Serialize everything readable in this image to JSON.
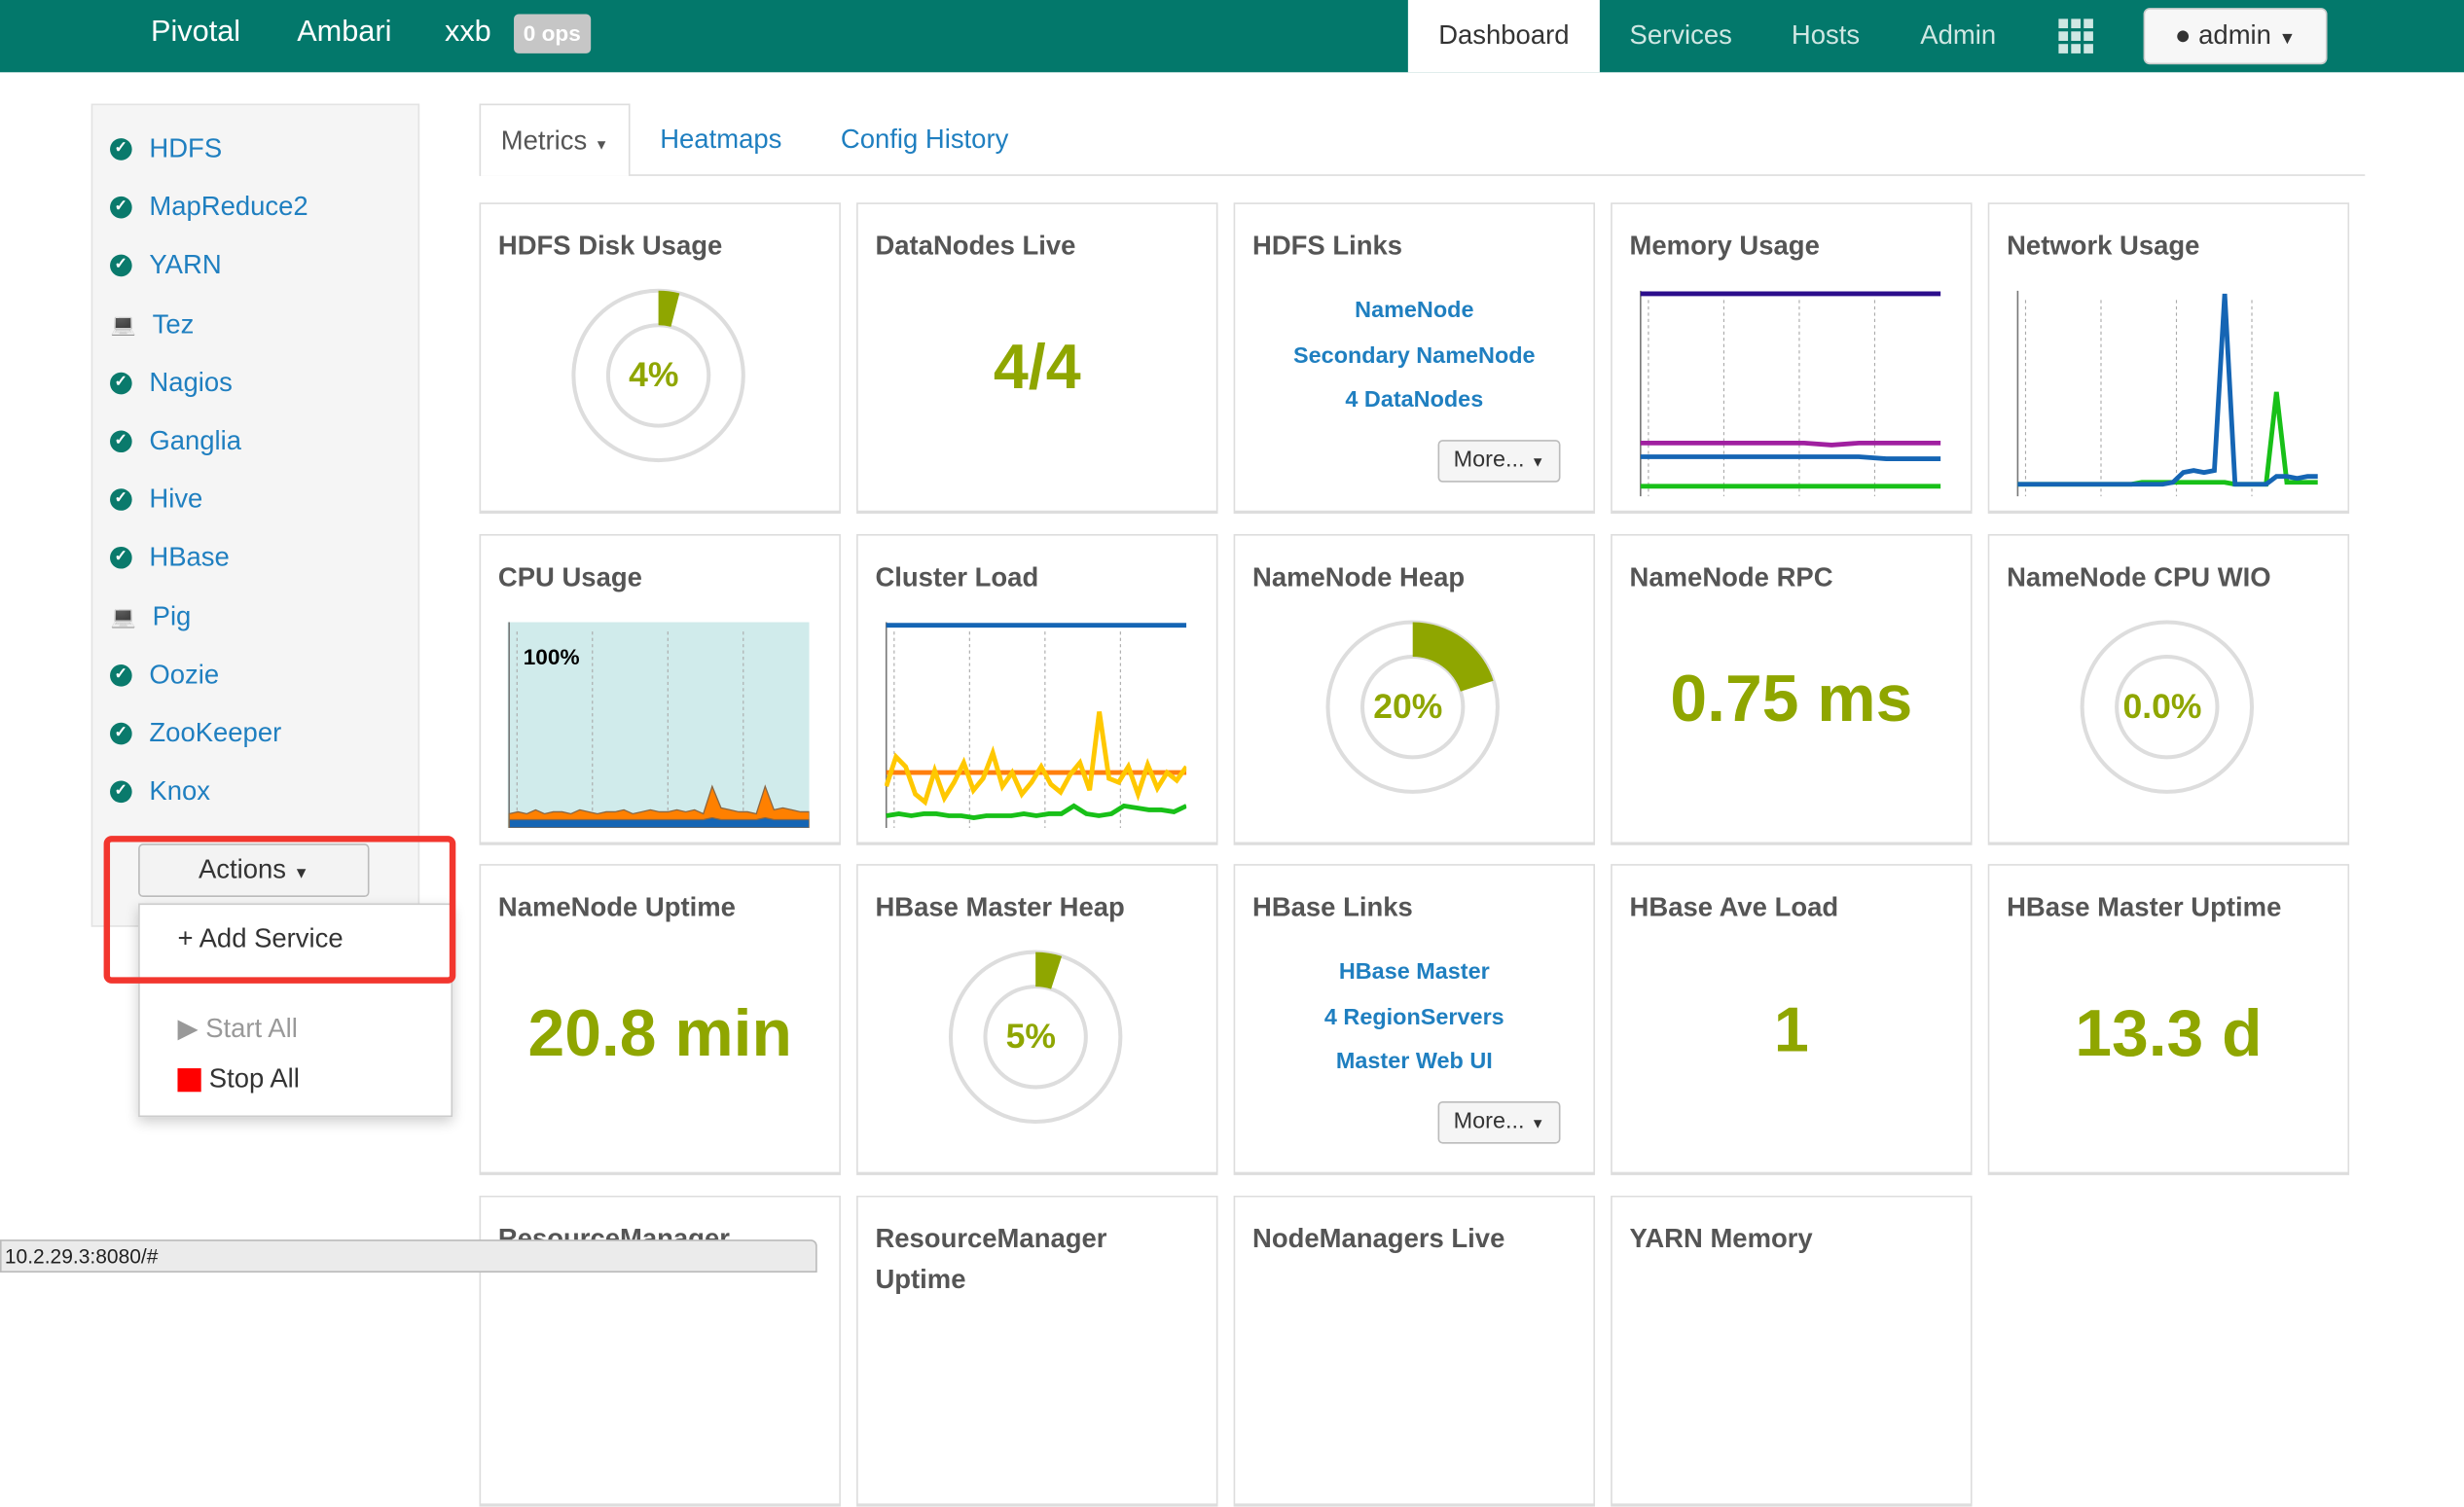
{
  "nav": {
    "brand": "Pivotal",
    "product": "Ambari",
    "cluster": "xxb",
    "ops_badge": "0 ops",
    "links": [
      "Dashboard",
      "Services",
      "Hosts",
      "Admin"
    ],
    "active": "Dashboard",
    "apps_icon": "grid-icon",
    "user": "admin",
    "color": "#03786b"
  },
  "sidebar": {
    "services": [
      {
        "name": "HDFS",
        "icon": "check-circle-icon"
      },
      {
        "name": "MapReduce2",
        "icon": "check-circle-icon"
      },
      {
        "name": "YARN",
        "icon": "check-circle-icon"
      },
      {
        "name": "Tez",
        "icon": "laptop-icon"
      },
      {
        "name": "Nagios",
        "icon": "check-circle-icon"
      },
      {
        "name": "Ganglia",
        "icon": "check-circle-icon"
      },
      {
        "name": "Hive",
        "icon": "check-circle-icon"
      },
      {
        "name": "HBase",
        "icon": "check-circle-icon"
      },
      {
        "name": "Pig",
        "icon": "laptop-icon"
      },
      {
        "name": "Oozie",
        "icon": "check-circle-icon"
      },
      {
        "name": "ZooKeeper",
        "icon": "check-circle-icon"
      },
      {
        "name": "Knox",
        "icon": "check-circle-icon"
      }
    ],
    "actions_label": "Actions",
    "menu": {
      "add": "+ Add Service",
      "start": "▶ Start All",
      "stop": "Stop All"
    }
  },
  "tabs": [
    "Metrics",
    "Heatmaps",
    "Config History"
  ],
  "widgets": {
    "hdfs_disk": {
      "title": "HDFS Disk Usage",
      "value": "4%",
      "percent": 4
    },
    "datanodes": {
      "title": "DataNodes Live",
      "value": "4/4"
    },
    "hdfs_links": {
      "title": "HDFS Links",
      "links": [
        "NameNode",
        "Secondary NameNode",
        "4 DataNodes"
      ],
      "more": "More..."
    },
    "memory": {
      "title": "Memory Usage"
    },
    "network": {
      "title": "Network Usage"
    },
    "cpu": {
      "title": "CPU Usage",
      "label": "100%"
    },
    "cluster_load": {
      "title": "Cluster Load"
    },
    "nn_heap": {
      "title": "NameNode Heap",
      "value": "20%",
      "percent": 20
    },
    "nn_rpc": {
      "title": "NameNode RPC",
      "value": "0.75 ms"
    },
    "nn_cpu": {
      "title": "NameNode CPU WIO",
      "value": "0.0%",
      "percent": 0
    },
    "nn_uptime": {
      "title": "NameNode Uptime",
      "value": "20.8 min"
    },
    "hbase_heap": {
      "title": "HBase Master Heap",
      "value": "5%",
      "percent": 5
    },
    "hbase_links": {
      "title": "HBase Links",
      "links": [
        "HBase Master",
        "4 RegionServers",
        "Master Web UI"
      ],
      "more": "More..."
    },
    "hbase_load": {
      "title": "HBase Ave Load",
      "value": "1"
    },
    "hbase_uptime": {
      "title": "HBase Master Uptime",
      "value": "13.3 d"
    },
    "rm_heap": {
      "title": "ResourceManager"
    },
    "rm_uptime": {
      "title": "ResourceManager Uptime"
    },
    "nm_live": {
      "title": "NodeManagers Live"
    },
    "yarn_mem": {
      "title": "YARN Memory"
    }
  },
  "status_url": "10.2.29.3:8080/#",
  "chart_data": [
    {
      "id": "memory",
      "type": "line",
      "ylim": [
        0,
        100
      ],
      "series": [
        {
          "color": "#2c0e8c",
          "values": [
            100,
            100,
            100,
            100,
            100,
            100,
            100,
            100,
            100,
            100,
            100,
            100
          ]
        },
        {
          "color": "#a020a0",
          "values": [
            24,
            24,
            24,
            24,
            24,
            24,
            24,
            23,
            24,
            24,
            24,
            24
          ]
        },
        {
          "color": "#1565b4",
          "values": [
            17,
            17,
            17,
            17,
            17,
            17,
            17,
            17,
            17,
            16,
            16,
            16
          ]
        },
        {
          "color": "#18c018",
          "values": [
            2,
            2,
            2,
            2,
            2,
            2,
            2,
            2,
            2,
            2,
            2,
            2
          ]
        }
      ]
    },
    {
      "id": "network",
      "type": "line",
      "ylim": [
        0,
        100
      ],
      "series": [
        {
          "color": "#18c018",
          "values": [
            3,
            3,
            3,
            3,
            3,
            3,
            3,
            3,
            3,
            3,
            3,
            3,
            4,
            4,
            4,
            4,
            4,
            4,
            4,
            4,
            4,
            3,
            3,
            3,
            3,
            50,
            4,
            4,
            4,
            4
          ]
        },
        {
          "color": "#1565b4",
          "values": [
            3,
            3,
            3,
            3,
            3,
            3,
            3,
            3,
            3,
            3,
            3,
            3,
            3,
            3,
            3,
            4,
            9,
            10,
            9,
            10,
            100,
            3,
            3,
            3,
            3,
            7,
            7,
            6,
            7,
            7
          ]
        }
      ]
    },
    {
      "id": "cpu",
      "type": "area",
      "ylim": [
        0,
        100
      ],
      "series": [
        {
          "color": "#ff8000",
          "values": [
            4,
            5,
            4,
            6,
            4,
            5,
            5,
            4,
            6,
            5,
            4,
            5,
            5,
            6,
            4,
            5,
            6,
            5,
            5,
            6,
            5,
            6,
            4,
            18,
            7,
            6,
            5,
            5,
            4,
            18,
            6,
            7,
            6,
            5,
            5
          ]
        },
        {
          "color": "#1565b4",
          "values": [
            1,
            1,
            1,
            1,
            1,
            1,
            1,
            1,
            1,
            1,
            1,
            1,
            1,
            1,
            1,
            1,
            1,
            1,
            1,
            1,
            1,
            1,
            1,
            2,
            1,
            1,
            1,
            1,
            1,
            2,
            1,
            1,
            1,
            1,
            1
          ]
        }
      ]
    },
    {
      "id": "cluster_load",
      "type": "line",
      "ylim": [
        0,
        100
      ],
      "series": [
        {
          "color": "#1565b4",
          "values": [
            100,
            100,
            100,
            100,
            100,
            100,
            100,
            100,
            100,
            100
          ]
        },
        {
          "color": "#ff7f0e",
          "values": [
            25,
            25,
            25,
            25,
            25,
            25,
            25,
            25,
            25,
            25
          ]
        },
        {
          "color": "#ffc800",
          "values": [
            18,
            33,
            28,
            14,
            10,
            26,
            12,
            20,
            30,
            16,
            22,
            35,
            18,
            25,
            14,
            20,
            28,
            19,
            15,
            24,
            30,
            16,
            56,
            22,
            20,
            28,
            14,
            29,
            17,
            25,
            21,
            28
          ]
        },
        {
          "color": "#18c018",
          "values": [
            3,
            4,
            3,
            4,
            4,
            3,
            3,
            2,
            3,
            3,
            3,
            4,
            3,
            4,
            4,
            8,
            4,
            3,
            4,
            8,
            7,
            6,
            6,
            5,
            8
          ]
        }
      ]
    }
  ]
}
